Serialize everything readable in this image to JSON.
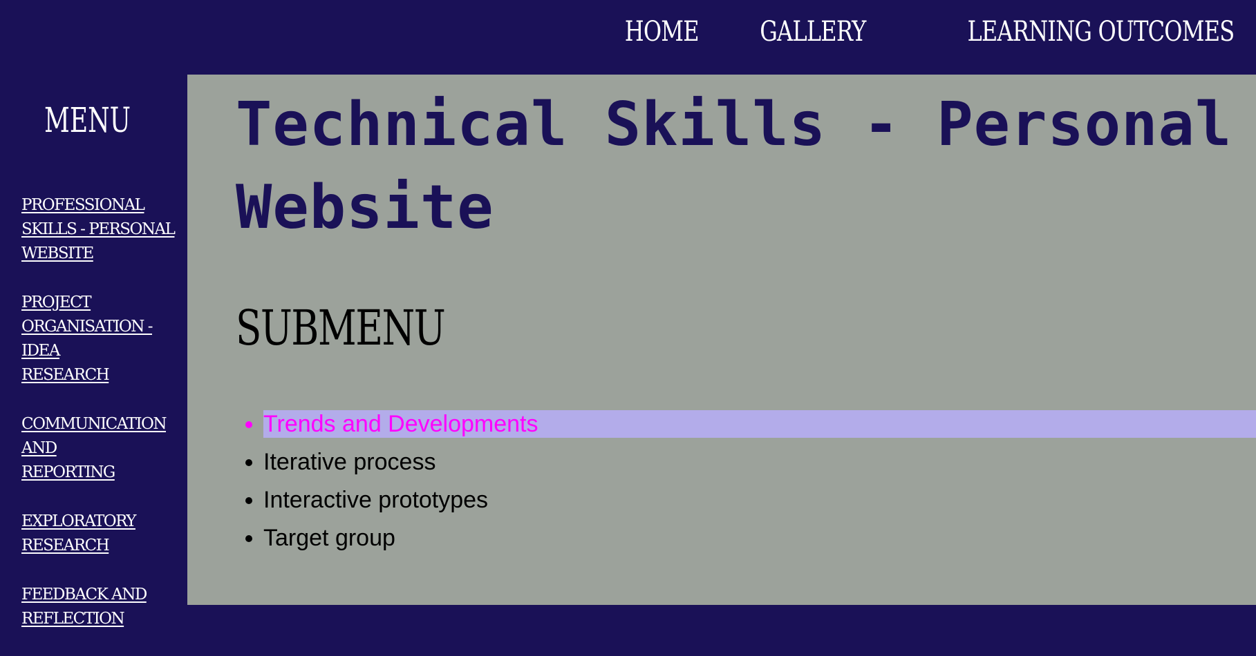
{
  "colors": {
    "navy": "#1a1157",
    "main_bg": "#9ca29b",
    "highlight_bg": "#b3acea",
    "active_text": "#ff00ff"
  },
  "topnav": {
    "items": [
      {
        "label": "HOME"
      },
      {
        "label": "GALLERY"
      },
      {
        "label": "LEARNING OUTCOMES"
      }
    ]
  },
  "sidebar": {
    "title": "MENU",
    "items": [
      {
        "label": "PROFESSIONAL\nSKILLS - PERSONAL\nWEBSITE"
      },
      {
        "label": "PROJECT\nORGANISATION - IDEA\nRESEARCH"
      },
      {
        "label": "COMMUNICATION AND\nREPORTING"
      },
      {
        "label": "EXPLORATORY\nRESEARCH"
      },
      {
        "label": "FEEDBACK AND\nREFLECTION"
      }
    ]
  },
  "main": {
    "title": "Technical Skills - Personal Website",
    "submenu_title": "SUBMENU",
    "submenu_items": [
      {
        "label": "Trends and Developments",
        "active": true
      },
      {
        "label": "Iterative process",
        "active": false
      },
      {
        "label": "Interactive prototypes",
        "active": false
      },
      {
        "label": "Target group",
        "active": false
      }
    ]
  }
}
